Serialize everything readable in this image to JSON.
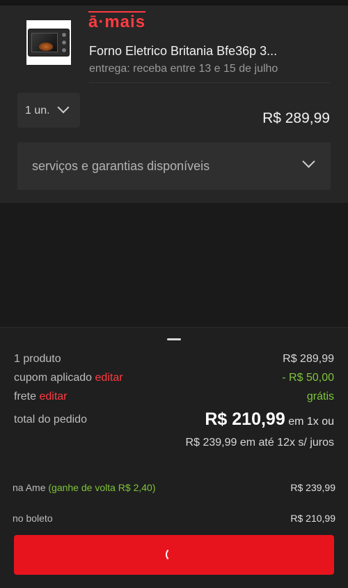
{
  "cart": {
    "store_logo": "ā·mais",
    "product_title": "Forno Eletrico Britania Bfe36p 3...",
    "delivery": "entrega: receba entre 13 e 15 de julho",
    "quantity": "1 un.",
    "price": "R$ 289,99",
    "services_label": "serviços e garantias disponíveis"
  },
  "summary": {
    "products_label": "1 produto",
    "products_value": "R$ 289,99",
    "coupon_label": "cupom aplicado",
    "coupon_edit": "editar",
    "coupon_value": "- R$ 50,00",
    "shipping_label": "frete",
    "shipping_edit": "editar",
    "shipping_value": "grátis",
    "total_label": "total do pedido",
    "total_value": "R$ 210,99",
    "total_suffix": "em 1x ou",
    "installments": "R$ 239,99 em até 12x s/ juros"
  },
  "payment": {
    "ame_label": "na Ame",
    "ame_cashback": "(ganhe de volta R$ 2,40)",
    "ame_value": "R$ 239,99",
    "boleto_label": "no boleto",
    "boleto_value": "R$ 210,99"
  },
  "icons": {
    "quantity_dropdown": "chevron-down-icon",
    "services_dropdown": "chevron-down-icon",
    "loading": "spinner-icon"
  },
  "colors": {
    "accent": "#e8141d",
    "link": "#ff3b41",
    "discount": "#7fc43a"
  }
}
